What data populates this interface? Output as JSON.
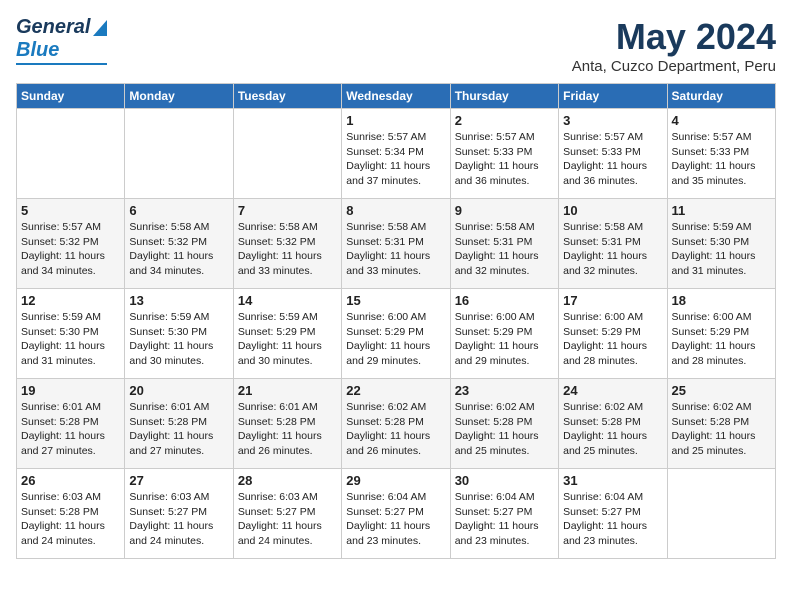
{
  "header": {
    "logo_general": "General",
    "logo_blue": "Blue",
    "main_title": "May 2024",
    "sub_title": "Anta, Cuzco Department, Peru"
  },
  "calendar": {
    "days_of_week": [
      "Sunday",
      "Monday",
      "Tuesday",
      "Wednesday",
      "Thursday",
      "Friday",
      "Saturday"
    ],
    "weeks": [
      {
        "days": [
          {
            "num": "",
            "info": ""
          },
          {
            "num": "",
            "info": ""
          },
          {
            "num": "",
            "info": ""
          },
          {
            "num": "1",
            "info": "Sunrise: 5:57 AM\nSunset: 5:34 PM\nDaylight: 11 hours\nand 37 minutes."
          },
          {
            "num": "2",
            "info": "Sunrise: 5:57 AM\nSunset: 5:33 PM\nDaylight: 11 hours\nand 36 minutes."
          },
          {
            "num": "3",
            "info": "Sunrise: 5:57 AM\nSunset: 5:33 PM\nDaylight: 11 hours\nand 36 minutes."
          },
          {
            "num": "4",
            "info": "Sunrise: 5:57 AM\nSunset: 5:33 PM\nDaylight: 11 hours\nand 35 minutes."
          }
        ]
      },
      {
        "days": [
          {
            "num": "5",
            "info": "Sunrise: 5:57 AM\nSunset: 5:32 PM\nDaylight: 11 hours\nand 34 minutes."
          },
          {
            "num": "6",
            "info": "Sunrise: 5:58 AM\nSunset: 5:32 PM\nDaylight: 11 hours\nand 34 minutes."
          },
          {
            "num": "7",
            "info": "Sunrise: 5:58 AM\nSunset: 5:32 PM\nDaylight: 11 hours\nand 33 minutes."
          },
          {
            "num": "8",
            "info": "Sunrise: 5:58 AM\nSunset: 5:31 PM\nDaylight: 11 hours\nand 33 minutes."
          },
          {
            "num": "9",
            "info": "Sunrise: 5:58 AM\nSunset: 5:31 PM\nDaylight: 11 hours\nand 32 minutes."
          },
          {
            "num": "10",
            "info": "Sunrise: 5:58 AM\nSunset: 5:31 PM\nDaylight: 11 hours\nand 32 minutes."
          },
          {
            "num": "11",
            "info": "Sunrise: 5:59 AM\nSunset: 5:30 PM\nDaylight: 11 hours\nand 31 minutes."
          }
        ]
      },
      {
        "days": [
          {
            "num": "12",
            "info": "Sunrise: 5:59 AM\nSunset: 5:30 PM\nDaylight: 11 hours\nand 31 minutes."
          },
          {
            "num": "13",
            "info": "Sunrise: 5:59 AM\nSunset: 5:30 PM\nDaylight: 11 hours\nand 30 minutes."
          },
          {
            "num": "14",
            "info": "Sunrise: 5:59 AM\nSunset: 5:29 PM\nDaylight: 11 hours\nand 30 minutes."
          },
          {
            "num": "15",
            "info": "Sunrise: 6:00 AM\nSunset: 5:29 PM\nDaylight: 11 hours\nand 29 minutes."
          },
          {
            "num": "16",
            "info": "Sunrise: 6:00 AM\nSunset: 5:29 PM\nDaylight: 11 hours\nand 29 minutes."
          },
          {
            "num": "17",
            "info": "Sunrise: 6:00 AM\nSunset: 5:29 PM\nDaylight: 11 hours\nand 28 minutes."
          },
          {
            "num": "18",
            "info": "Sunrise: 6:00 AM\nSunset: 5:29 PM\nDaylight: 11 hours\nand 28 minutes."
          }
        ]
      },
      {
        "days": [
          {
            "num": "19",
            "info": "Sunrise: 6:01 AM\nSunset: 5:28 PM\nDaylight: 11 hours\nand 27 minutes."
          },
          {
            "num": "20",
            "info": "Sunrise: 6:01 AM\nSunset: 5:28 PM\nDaylight: 11 hours\nand 27 minutes."
          },
          {
            "num": "21",
            "info": "Sunrise: 6:01 AM\nSunset: 5:28 PM\nDaylight: 11 hours\nand 26 minutes."
          },
          {
            "num": "22",
            "info": "Sunrise: 6:02 AM\nSunset: 5:28 PM\nDaylight: 11 hours\nand 26 minutes."
          },
          {
            "num": "23",
            "info": "Sunrise: 6:02 AM\nSunset: 5:28 PM\nDaylight: 11 hours\nand 25 minutes."
          },
          {
            "num": "24",
            "info": "Sunrise: 6:02 AM\nSunset: 5:28 PM\nDaylight: 11 hours\nand 25 minutes."
          },
          {
            "num": "25",
            "info": "Sunrise: 6:02 AM\nSunset: 5:28 PM\nDaylight: 11 hours\nand 25 minutes."
          }
        ]
      },
      {
        "days": [
          {
            "num": "26",
            "info": "Sunrise: 6:03 AM\nSunset: 5:28 PM\nDaylight: 11 hours\nand 24 minutes."
          },
          {
            "num": "27",
            "info": "Sunrise: 6:03 AM\nSunset: 5:27 PM\nDaylight: 11 hours\nand 24 minutes."
          },
          {
            "num": "28",
            "info": "Sunrise: 6:03 AM\nSunset: 5:27 PM\nDaylight: 11 hours\nand 24 minutes."
          },
          {
            "num": "29",
            "info": "Sunrise: 6:04 AM\nSunset: 5:27 PM\nDaylight: 11 hours\nand 23 minutes."
          },
          {
            "num": "30",
            "info": "Sunrise: 6:04 AM\nSunset: 5:27 PM\nDaylight: 11 hours\nand 23 minutes."
          },
          {
            "num": "31",
            "info": "Sunrise: 6:04 AM\nSunset: 5:27 PM\nDaylight: 11 hours\nand 23 minutes."
          },
          {
            "num": "",
            "info": ""
          }
        ]
      }
    ]
  }
}
